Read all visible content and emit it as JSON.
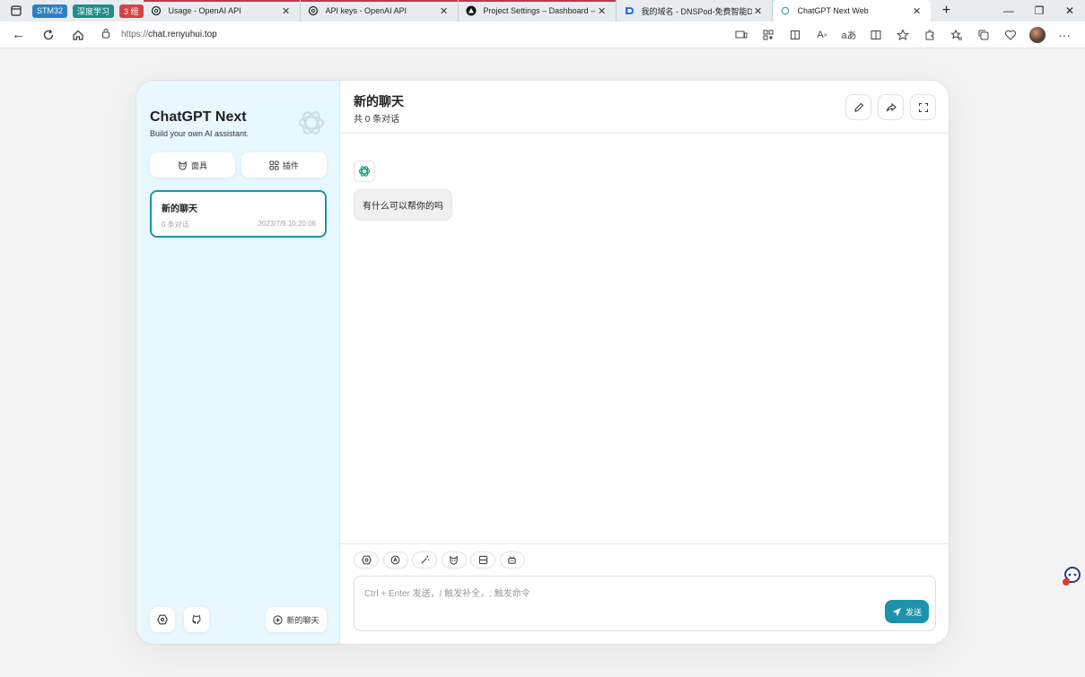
{
  "browser": {
    "groups": [
      {
        "label": "STM32",
        "color": "#2f80c1"
      },
      {
        "label": "深度学习",
        "color": "#1f8f8a"
      },
      {
        "label": "3 组",
        "color": "#d14444"
      }
    ],
    "tabs": [
      {
        "title": "Usage - OpenAI API",
        "icon": "openai-icon"
      },
      {
        "title": "API keys - OpenAI API",
        "icon": "openai-icon"
      },
      {
        "title": "Project Settings – Dashboard –",
        "icon": "vercel-icon"
      },
      {
        "title": "我的域名 - DNSPod-免费智能DNS",
        "icon": "dnspod-icon"
      },
      {
        "title": "ChatGPT Next Web",
        "icon": "chatgpt-icon"
      }
    ],
    "url_protocol": "https://",
    "url_host": "chat.renyuhui.top"
  },
  "sidebar": {
    "title": "ChatGPT Next",
    "subtitle": "Build your own AI assistant.",
    "mask_button": "面具",
    "plugin_button": "插件",
    "chats": [
      {
        "title": "新的聊天",
        "count": "0 条对话",
        "date": "2023/7/9 10:20:06"
      }
    ],
    "new_chat_button": "新的聊天"
  },
  "chat": {
    "title": "新的聊天",
    "subtitle": "共 0 条对话",
    "bot_message": "有什么可以帮你的吗",
    "input_placeholder": "Ctrl + Enter 发送，/ 触发补全，: 触发命令",
    "send_button": "发送"
  },
  "colors": {
    "accent": "#1d93ab",
    "sidebar_bg": "#e7f8ff"
  }
}
